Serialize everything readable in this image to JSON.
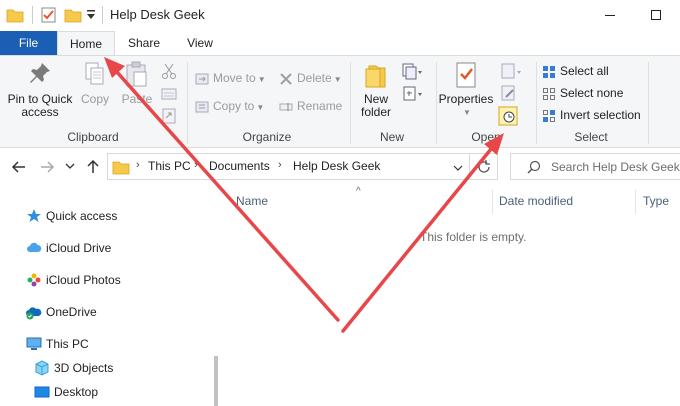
{
  "window": {
    "title": "Help Desk Geek",
    "quick_access_icons": [
      "folder-icon",
      "properties-checkbox-icon",
      "new-folder-icon",
      "customize-dropdown-icon"
    ],
    "controls": [
      "minimize-icon",
      "maximize-icon"
    ]
  },
  "ribbon": {
    "tabs": {
      "file": "File",
      "home": "Home",
      "share": "Share",
      "view": "View"
    },
    "active_tab": "Home",
    "clipboard": {
      "label": "Clipboard",
      "pin": "Pin to Quick access",
      "pin_l1": "Pin to Quick",
      "pin_l2": "access",
      "copy": "Copy",
      "paste": "Paste"
    },
    "organize": {
      "label": "Organize",
      "move_to": "Move to",
      "copy_to": "Copy to",
      "delete": "Delete",
      "rename": "Rename"
    },
    "new": {
      "label": "New",
      "new_folder": "New folder",
      "nf_l1": "New",
      "nf_l2": "folder"
    },
    "open": {
      "label": "Open",
      "properties": "Properties"
    },
    "select": {
      "label": "Select",
      "select_all": "Select all",
      "select_none": "Select none",
      "invert": "Invert selection"
    }
  },
  "address": {
    "breadcrumbs": [
      "This PC",
      "Documents",
      "Help Desk Geek"
    ],
    "search_placeholder": "Search Help Desk Geek"
  },
  "nav_pane": {
    "items": [
      {
        "label": "Quick access",
        "icon": "star-icon"
      },
      {
        "label": "iCloud Drive",
        "icon": "icloud-icon"
      },
      {
        "label": "iCloud Photos",
        "icon": "icloud-photos-icon"
      },
      {
        "label": "OneDrive",
        "icon": "onedrive-icon"
      },
      {
        "label": "This PC",
        "icon": "computer-icon"
      },
      {
        "label": "3D Objects",
        "icon": "3d-objects-icon"
      },
      {
        "label": "Desktop",
        "icon": "desktop-icon"
      }
    ]
  },
  "content": {
    "columns": [
      "Name",
      "Date modified",
      "Type"
    ],
    "empty_message": "This folder is empty."
  },
  "annotations": {
    "arrow_color": "#e8474a"
  },
  "colors": {
    "file_tab": "#1a5fb4",
    "ribbon_bg": "#f5f6f7"
  }
}
